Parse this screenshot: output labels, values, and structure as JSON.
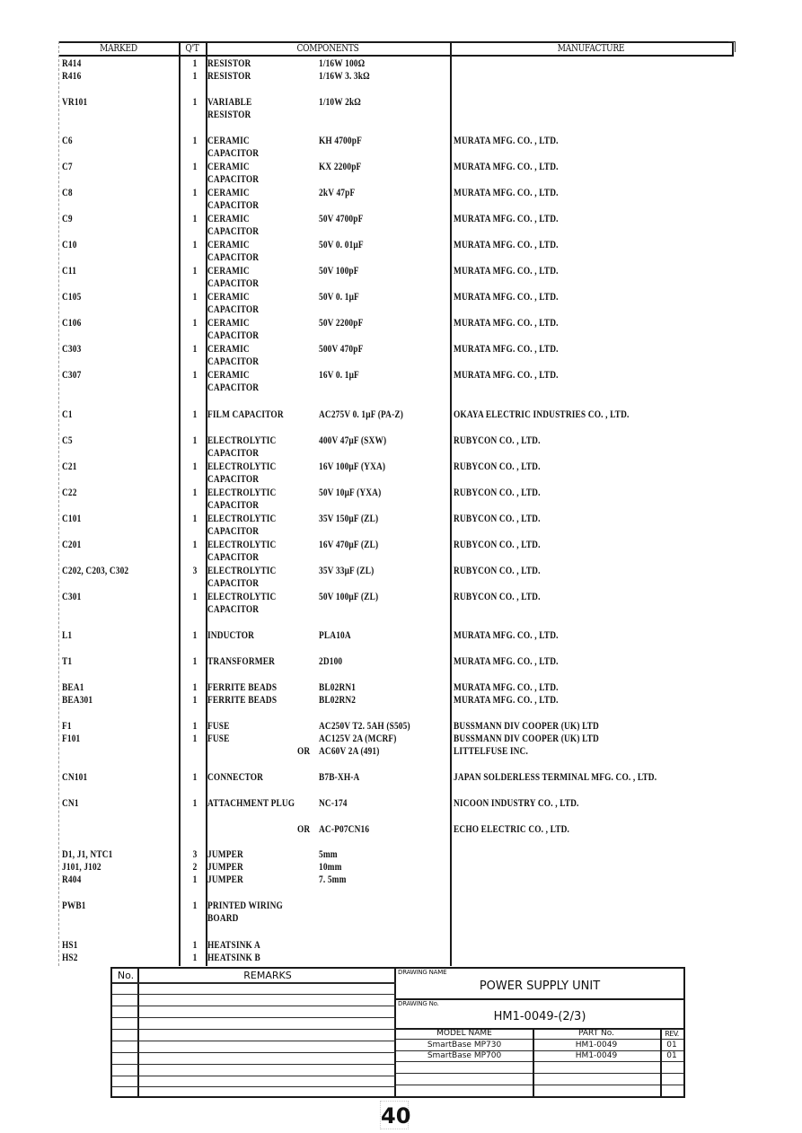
{
  "table": {
    "headers": {
      "marked": "MARKED",
      "qty": "Q'T",
      "components": "COMPONENTS",
      "manufacture": "MANUFACTURE"
    },
    "rows": [
      {
        "marked": "R414",
        "qty": "1",
        "component": "RESISTOR",
        "spec": "1/16W 100Ω",
        "manufacturer": ""
      },
      {
        "marked": "R416",
        "qty": "1",
        "component": "RESISTOR",
        "spec": "1/16W 3. 3kΩ",
        "manufacturer": ""
      },
      {
        "marked": "VR101",
        "qty": "1",
        "component": "VARIABLE",
        "component2": "RESISTOR",
        "spec": "1/10W 2kΩ",
        "manufacturer": ""
      },
      {
        "marked": "C6",
        "qty": "1",
        "component": "CERAMIC",
        "component2": "CAPACITOR",
        "spec": "KH 4700pF",
        "manufacturer": "MURATA MFG. CO. , LTD."
      },
      {
        "marked": "C7",
        "qty": "1",
        "component": "CERAMIC",
        "component2": "CAPACITOR",
        "spec": "KX  2200pF",
        "manufacturer": "MURATA MFG. CO. , LTD."
      },
      {
        "marked": "C8",
        "qty": "1",
        "component": "CERAMIC",
        "component2": "CAPACITOR",
        "spec": "2kV 47pF",
        "manufacturer": "MURATA MFG. CO. , LTD."
      },
      {
        "marked": "C9",
        "qty": "1",
        "component": "CERAMIC",
        "component2": "CAPACITOR",
        "spec": "50V 4700pF",
        "manufacturer": "MURATA MFG. CO. , LTD."
      },
      {
        "marked": "C10",
        "qty": "1",
        "component": "CERAMIC",
        "component2": "CAPACITOR",
        "spec": "50V 0. 01μF",
        "manufacturer": "MURATA MFG. CO. , LTD."
      },
      {
        "marked": "C11",
        "qty": "1",
        "component": "CERAMIC",
        "component2": "CAPACITOR",
        "spec": "50V 100pF",
        "manufacturer": "MURATA MFG. CO. , LTD."
      },
      {
        "marked": "C105",
        "qty": "1",
        "component": "CERAMIC",
        "component2": "CAPACITOR",
        "spec": "50V 0. 1μF",
        "manufacturer": "MURATA MFG. CO. , LTD."
      },
      {
        "marked": "C106",
        "qty": "1",
        "component": "CERAMIC",
        "component2": "CAPACITOR",
        "spec": "50V 2200pF",
        "manufacturer": "MURATA MFG. CO. , LTD."
      },
      {
        "marked": "C303",
        "qty": "1",
        "component": "CERAMIC",
        "component2": "CAPACITOR",
        "spec": "500V 470pF",
        "manufacturer": "MURATA MFG. CO. , LTD."
      },
      {
        "marked": "C307",
        "qty": "1",
        "component": "CERAMIC",
        "component2": "CAPACITOR",
        "spec": "16V 0. 1μF",
        "manufacturer": "MURATA MFG. CO. , LTD."
      },
      {
        "marked": "C1",
        "qty": "1",
        "component": "FILM CAPACITOR",
        "spec": "AC275V 0. 1μF (PA-Z)",
        "manufacturer": "OKAYA ELECTRIC INDUSTRIES CO. , LTD."
      },
      {
        "marked": "C5",
        "qty": "1",
        "component": "ELECTROLYTIC",
        "component2": "CAPACITOR",
        "spec": "400V 47μF (SXW)",
        "manufacturer": "RUBYCON CO. , LTD."
      },
      {
        "marked": "C21",
        "qty": "1",
        "component": "ELECTROLYTIC",
        "component2": "CAPACITOR",
        "spec": "16V 100μF (YXA)",
        "manufacturer": "RUBYCON CO. , LTD."
      },
      {
        "marked": "C22",
        "qty": "1",
        "component": "ELECTROLYTIC",
        "component2": "CAPACITOR",
        "spec": "50V 10μF (YXA)",
        "manufacturer": "RUBYCON CO. , LTD."
      },
      {
        "marked": "C101",
        "qty": "1",
        "component": "ELECTROLYTIC",
        "component2": "CAPACITOR",
        "spec": "35V 150μF (ZL)",
        "manufacturer": "RUBYCON CO. , LTD."
      },
      {
        "marked": "C201",
        "qty": "1",
        "component": "ELECTROLYTIC",
        "component2": "CAPACITOR",
        "spec": "16V 470μF (ZL)",
        "manufacturer": "RUBYCON CO. , LTD."
      },
      {
        "marked": "C202, C203, C302",
        "qty": "3",
        "component": "ELECTROLYTIC",
        "component2": "CAPACITOR",
        "spec": "35V 33μF (ZL)",
        "manufacturer": "RUBYCON CO. , LTD."
      },
      {
        "marked": "C301",
        "qty": "1",
        "component": "ELECTROLYTIC",
        "component2": "CAPACITOR",
        "spec": "50V 100μF (ZL)",
        "manufacturer": "RUBYCON CO. , LTD."
      },
      {
        "marked": "L1",
        "qty": "1",
        "component": "INDUCTOR",
        "spec": "PLA10A",
        "manufacturer": "MURATA MFG. CO. , LTD."
      },
      {
        "marked": "T1",
        "qty": "1",
        "component": "TRANSFORMER",
        "spec": "2D100",
        "manufacturer": "MURATA MFG. CO. , LTD."
      },
      {
        "marked": "BEA1",
        "qty": "1",
        "component": "FERRITE BEADS",
        "spec": "BL02RN1",
        "manufacturer": "MURATA MFG. CO. , LTD."
      },
      {
        "marked": "BEA301",
        "qty": "1",
        "component": "FERRITE BEADS",
        "spec": "BL02RN2",
        "manufacturer": "MURATA MFG. CO. , LTD."
      },
      {
        "marked": "F1",
        "qty": "1",
        "component": "FUSE",
        "spec": "AC250V T2. 5AH (S505)",
        "manufacturer": "BUSSMANN DIV COOPER (UK) LTD"
      },
      {
        "marked": "F101",
        "qty": "1",
        "component": "FUSE",
        "spec": "AC125V 2A (MCRF)",
        "manufacturer": "BUSSMANN DIV COOPER (UK) LTD"
      },
      {
        "marked": "",
        "qty": "",
        "component": "",
        "or": "OR",
        "spec": "AC60V 2A (491)",
        "manufacturer": "LITTELFUSE INC."
      },
      {
        "marked": "CN101",
        "qty": "1",
        "component": "CONNECTOR",
        "spec": "B7B-XH-A",
        "manufacturer": "JAPAN SOLDERLESS TERMINAL MFG. CO. , LTD."
      },
      {
        "marked": "CN1",
        "qty": "1",
        "component": "ATTACHMENT PLUG",
        "spec": "NC-174",
        "manufacturer": "NICOON INDUSTRY CO. , LTD."
      },
      {
        "marked": "",
        "qty": "",
        "component": "",
        "or": "OR",
        "spec": "AC-P07CN16",
        "manufacturer": "ECHO ELECTRIC CO. , LTD."
      },
      {
        "marked": "D1, J1, NTC1",
        "qty": "3",
        "component": "JUMPER",
        "spec": "5mm",
        "manufacturer": ""
      },
      {
        "marked": "J101, J102",
        "qty": "2",
        "component": "JUMPER",
        "spec": "10mm",
        "manufacturer": ""
      },
      {
        "marked": "R404",
        "qty": "1",
        "component": "JUMPER",
        "spec": "7. 5mm",
        "manufacturer": ""
      },
      {
        "marked": "PWB1",
        "qty": "1",
        "component": "PRINTED WIRING",
        "component2": "BOARD",
        "spec": "",
        "manufacturer": ""
      },
      {
        "marked": "HS1",
        "qty": "1",
        "component": "HEATSINK A",
        "spec": "",
        "manufacturer": ""
      },
      {
        "marked": "HS2",
        "qty": "1",
        "component": "HEATSINK B",
        "spec": "",
        "manufacturer": ""
      }
    ]
  },
  "title_block": {
    "no_label": "No.",
    "remarks_label": "REMARKS",
    "drawing_name_label": "DRAWING NAME",
    "drawing_name": "POWER  SUPPLY  UNIT",
    "drawing_no_label": "DRAWING No.",
    "drawing_no": "HM1-0049-(2/3)",
    "model_header": "MODEL NAME",
    "part_header": "PART No.",
    "rev_header": "REV.",
    "models": [
      {
        "model": "SmartBase  MP730",
        "part": "HM1-0049",
        "rev": "01"
      },
      {
        "model": "SmartBase  MP700",
        "part": "HM1-0049",
        "rev": "01"
      }
    ]
  },
  "page_number": "40"
}
